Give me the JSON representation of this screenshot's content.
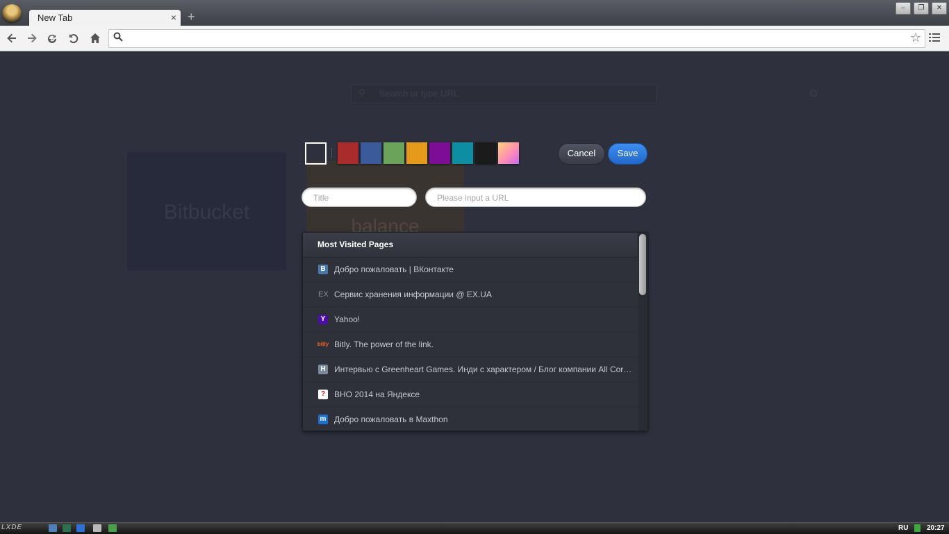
{
  "browser": {
    "tab_title": "New Tab",
    "tab_close_glyph": "×",
    "new_tab_glyph": "+",
    "window_buttons": {
      "minimize": "–",
      "restore": "❐",
      "close": "✕"
    },
    "address": {
      "value": "",
      "placeholder": ""
    }
  },
  "page": {
    "search_placeholder": "Search or type URL",
    "tiles": [
      {
        "label": "Bitbucket"
      },
      {
        "label": "balance"
      }
    ]
  },
  "editor": {
    "colors": [
      "#ffffff",
      "#a92b2b",
      "#3b5a9a",
      "#6aa45a",
      "#e69a1c",
      "#7d0d94",
      "#0e8ea3",
      "#1b1b1b",
      "gradient"
    ],
    "cancel_label": "Cancel",
    "save_label": "Save",
    "title_field": {
      "value": "",
      "placeholder": "Title"
    },
    "url_field": {
      "value": "",
      "placeholder": "Please input a URL"
    }
  },
  "most_visited": {
    "header": "Most Visited Pages",
    "items": [
      {
        "icon": "vk-icon",
        "icon_glyph": "B",
        "icon_color": "#4a76a8",
        "label": "Добро пожаловать | ВКонтакте"
      },
      {
        "icon": "exua-icon",
        "icon_glyph": "EX",
        "icon_color": "#2e313a",
        "label": "Сервис хранения информации @ EX.UA"
      },
      {
        "icon": "yahoo-icon",
        "icon_glyph": "Y",
        "icon_color": "#4b0fa3",
        "label": "Yahoo!"
      },
      {
        "icon": "bitly-icon",
        "icon_glyph": "bitly",
        "icon_color": "#2e313a",
        "label": "Bitly. The power of the link."
      },
      {
        "icon": "habr-icon",
        "icon_glyph": "H",
        "icon_color": "#7a8a9a",
        "label": "Интервью с Greenheart Games. Инди с характером / Блог компании All Correct Localization / Хабрахабр"
      },
      {
        "icon": "yandex-question-icon",
        "icon_glyph": "?",
        "icon_color": "#ffffff",
        "label": "ВНО 2014 на Яндексе"
      },
      {
        "icon": "maxthon-icon",
        "icon_glyph": "m",
        "icon_color": "#1f6fd0",
        "label": "Добро пожаловать в Maxthon"
      }
    ]
  },
  "taskbar": {
    "logo_text": "LXDE",
    "language": "RU",
    "clock": "20:27"
  }
}
